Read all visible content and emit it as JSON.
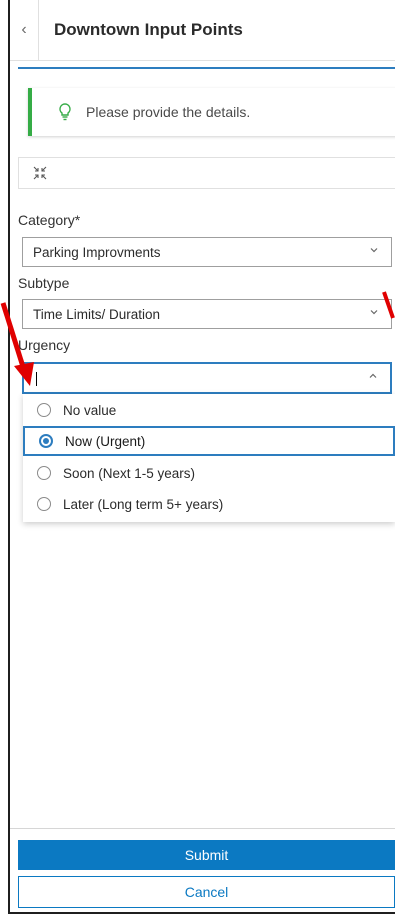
{
  "header": {
    "title": "Downtown Input Points",
    "back_icon": "chevron-left-icon"
  },
  "notice": {
    "text": "Please provide the details.",
    "icon": "lightbulb-icon",
    "accent": "#35ac46"
  },
  "collapse": {
    "icon": "collapse-arrows-icon"
  },
  "fields": {
    "category": {
      "label": "Category*",
      "value": "Parking Improvments"
    },
    "subtype": {
      "label": "Subtype",
      "value": "Time Limits/ Duration"
    },
    "urgency": {
      "label": "Urgency",
      "value": "",
      "options": [
        {
          "label": "No value",
          "selected": false
        },
        {
          "label": "Now (Urgent)",
          "selected": true
        },
        {
          "label": "Soon (Next 1-5 years)",
          "selected": false
        },
        {
          "label": "Later (Long term 5+ years)",
          "selected": false
        }
      ]
    }
  },
  "actions": {
    "submit": "Submit",
    "cancel": "Cancel"
  },
  "colors": {
    "accent": "#2d7dbf",
    "primary_button": "#0b79c2",
    "annotation": "#e00000"
  }
}
